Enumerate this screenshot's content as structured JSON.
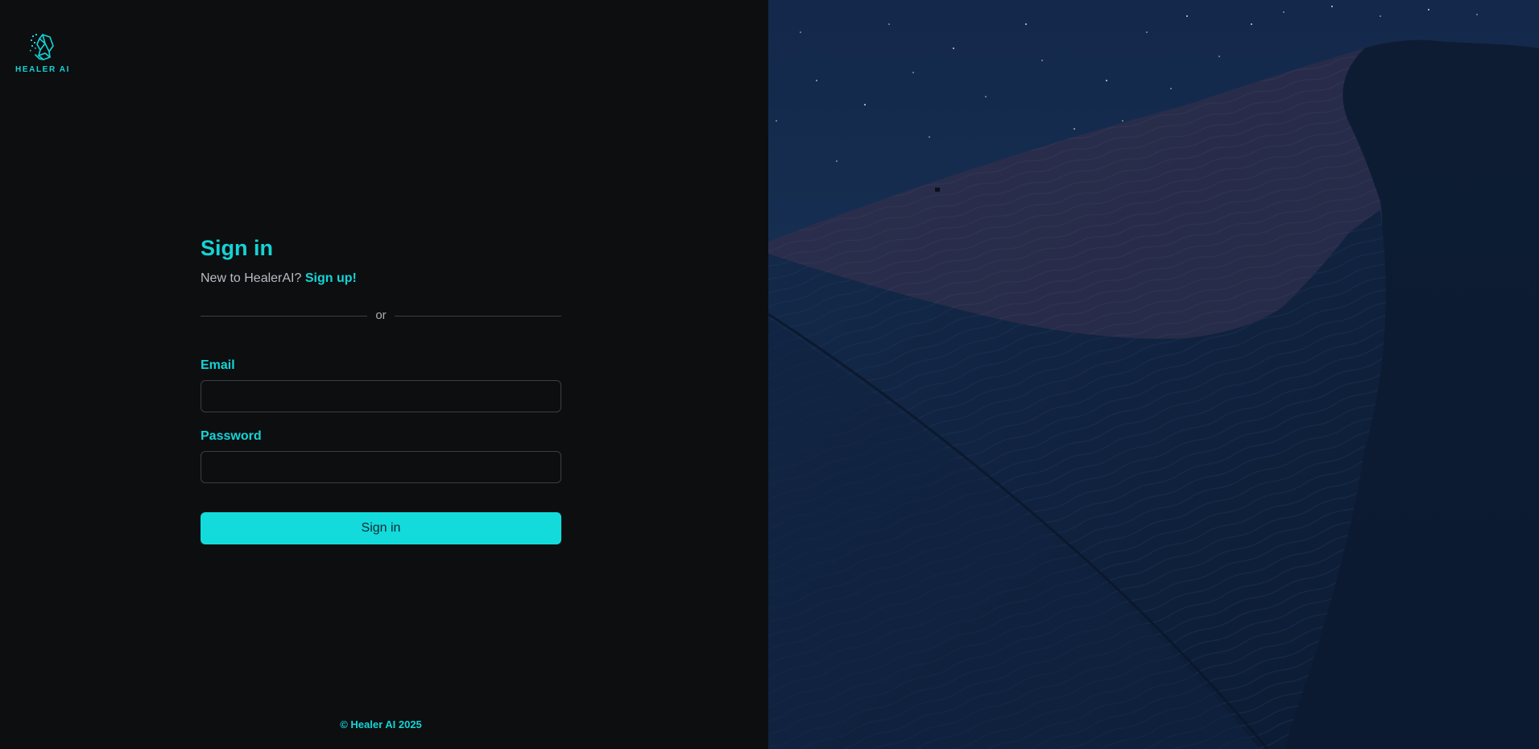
{
  "brand": {
    "logo_icon": "healer-ai-logo-icon",
    "logo_text": "HEALER AI",
    "accent_color": "#14d4d6"
  },
  "signin": {
    "title": "Sign in",
    "prompt": "New to HealerAI?",
    "signup_link": "Sign up!",
    "divider_text": "or",
    "email_label": "Email",
    "email_value": "",
    "password_label": "Password",
    "password_value": "",
    "submit_label": "Sign in"
  },
  "footer": {
    "copyright": "© Healer AI 2025"
  },
  "hero": {
    "image": "night-sand-dunes-image"
  }
}
